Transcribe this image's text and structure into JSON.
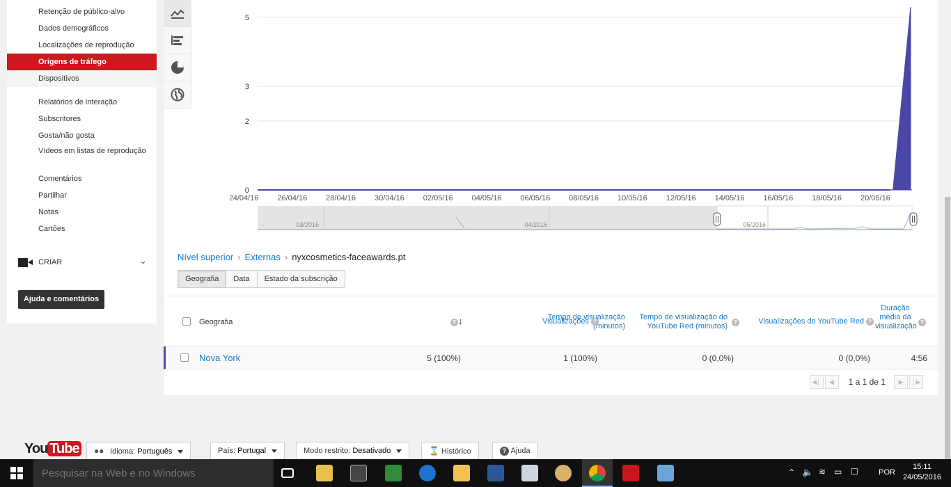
{
  "sidebar": {
    "items": [
      {
        "label": "Retenção de público-alvo"
      },
      {
        "label": "Dados demográficos"
      },
      {
        "label": "Localizações de reprodução"
      },
      {
        "label": "Origens de tráfego",
        "active": true
      },
      {
        "label": "Dispositivos"
      },
      {
        "label": "Relatórios de interação"
      },
      {
        "label": "Subscritores"
      },
      {
        "label": "Gosta/não gosta"
      },
      {
        "label": "Vídeos em listas de reprodução"
      },
      {
        "label": "Comentários"
      },
      {
        "label": "Partilhar"
      },
      {
        "label": "Notas"
      },
      {
        "label": "Cartões"
      }
    ],
    "create_label": "CRIAR",
    "help_button": "Ajuda e comentários"
  },
  "chart_tabs": [
    "line-chart-icon",
    "bar-chart-icon",
    "pie-chart-icon",
    "globe-icon"
  ],
  "chart_data": {
    "type": "area",
    "x": [
      "24/04/16",
      "26/04/16",
      "28/04/16",
      "30/04/16",
      "02/05/16",
      "04/05/16",
      "06/05/16",
      "08/05/16",
      "10/05/16",
      "12/05/16",
      "14/05/16",
      "16/05/16",
      "18/05/16",
      "20/05/16"
    ],
    "y_ticks": [
      0,
      2,
      3,
      5
    ],
    "series": [
      {
        "values": [
          0,
          0,
          0,
          0,
          0,
          0,
          0,
          0,
          0,
          0,
          0,
          0,
          0,
          0,
          0,
          0,
          0,
          0,
          0,
          0,
          0,
          0,
          0,
          0,
          0,
          0,
          0,
          0,
          0,
          0,
          5.3
        ]
      }
    ],
    "ylim": [
      0,
      5.3
    ],
    "color": "#4b47a8",
    "timeline_labels": [
      "03/2016",
      "04/2016",
      "05/2016"
    ]
  },
  "breadcrumb": {
    "top": "Nível superior",
    "external": "Externas",
    "current": "nyxcosmetics-faceawards.pt"
  },
  "tabs": [
    "Geografia",
    "Data",
    "Estado da subscrição"
  ],
  "table": {
    "headers": {
      "geo": "Geografia",
      "watch_time": "Tempo de visualização (minutos)",
      "views": "Visualizações",
      "red_watch": "Tempo de visualização do YouTube Red (minutos)",
      "red_views": "Visualizações do YouTube Red",
      "avg_duration": "Duração média da visualização"
    },
    "row": {
      "geo": "Nova York",
      "watch_time": "5 (100%)",
      "views": "1 (100%)",
      "red_watch": "0 (0,0%)",
      "red_views": "0 (0,0%)",
      "avg_duration": "4:56"
    },
    "pager": "1 a 1 de 1"
  },
  "footer": {
    "logo_you": "You",
    "logo_tube": "Tube",
    "language_label": "Idioma:",
    "language_value": "Português",
    "country_label": "País:",
    "country_value": "Portugal",
    "restricted_label": "Modo restrito:",
    "restricted_value": "Desativado",
    "history": "Histórico",
    "help": "Ajuda"
  },
  "taskbar": {
    "search_placeholder": "Pesquisar na Web e no Windows",
    "lang": "POR",
    "time": "15:11",
    "date": "24/05/2016"
  }
}
